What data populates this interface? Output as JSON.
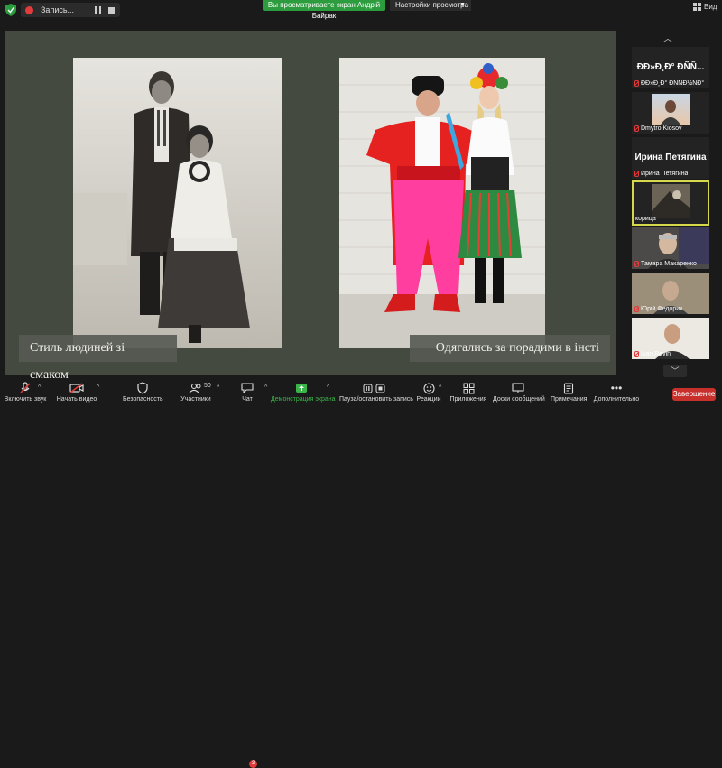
{
  "topbar": {
    "recording_label": "Запись...",
    "share_banner": "Вы просматриваете экран Андрій Байрак",
    "view_options": "Настройки просмотра",
    "view_button": "Вид"
  },
  "slide": {
    "caption_left": "Стиль людиней зі смаком",
    "caption_right": "Одягались за порадими в інсті"
  },
  "gallery": {
    "tiles": [
      {
        "big": "ÐÐ»Ð¸Ð° ÐÑÑ...",
        "name": "ÐÐ»Ð¸Ð° ÐÑÑÐ½ÑÐ°"
      },
      {
        "name": "Dmytro Kiosov"
      },
      {
        "big": "Ирина Петягина",
        "name": "Ирина Петягина"
      },
      {
        "name": "корица"
      },
      {
        "name": "Тамара Макаренко"
      },
      {
        "name": "Юрій Федорик"
      },
      {
        "name": "Ivan Revin"
      }
    ]
  },
  "toolbar": {
    "audio": "Включить звук",
    "video": "Начать видео",
    "security": "Безопасность",
    "participants": "Участники",
    "participants_count": "50",
    "chat": "Чат",
    "chat_badge": "3",
    "share": "Демонстрация экрана",
    "pause_record": "Пауза/остановить запись",
    "reactions": "Реакции",
    "apps": "Приложения",
    "whiteboards": "Доски сообщений",
    "notes": "Примечания",
    "more": "Дополнительно",
    "end": "Завершение"
  },
  "colors": {
    "share_green": "#2d9c3e",
    "end_red": "#c8302c",
    "active_tile_border": "#d4d84a",
    "slide_bg": "#454a40"
  }
}
